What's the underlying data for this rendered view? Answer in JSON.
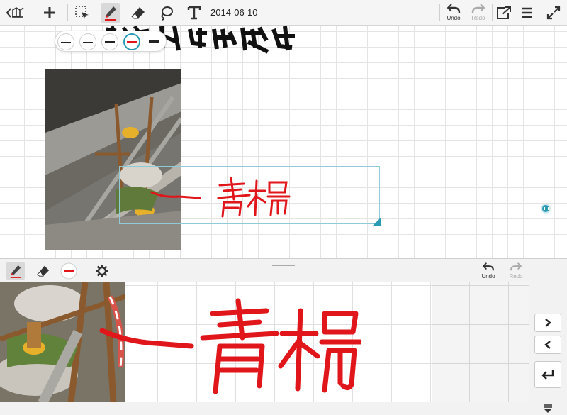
{
  "toolbar": {
    "date": "2014-06-10",
    "undo_label": "Undo",
    "redo_label": "Redo"
  },
  "icons": {
    "back": "notebook-back-icon",
    "add": "plus-icon",
    "select": "selection-icon",
    "pen": "pen-icon",
    "eraser": "eraser-icon",
    "lasso": "lasso-icon",
    "text": "text-icon",
    "undo": "undo-icon",
    "redo": "redo-icon",
    "share": "share-icon",
    "menu": "menu-icon",
    "fullscreen": "expand-icon",
    "settings": "gear-icon"
  },
  "zoom_panel": {
    "undo_label": "Undo",
    "redo_label": "Redo"
  },
  "colors": {
    "accent": "#2b9bb5",
    "ink_red": "#e0161b",
    "toolbar_bg": "#f5f5f5"
  }
}
